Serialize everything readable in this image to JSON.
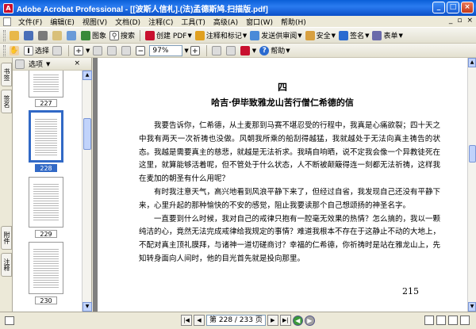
{
  "window": {
    "title": "Adobe Acrobat Professional - [[波斯人信札].(法)孟德斯鸠.扫描版.pdf]",
    "app_icon": "A",
    "min": "_",
    "max": "□",
    "close": "×"
  },
  "menu": {
    "items": [
      "文件(F)",
      "编辑(E)",
      "视图(V)",
      "文档(D)",
      "注释(C)",
      "工具(T)",
      "高级(A)",
      "窗口(W)",
      "帮助(H)"
    ],
    "right": [
      "_",
      "▫",
      "×"
    ]
  },
  "toolbar1": {
    "image_label": "图象",
    "search_label": "搜索",
    "create_pdf_label": "创建 PDF",
    "comment_label": "注释和标记",
    "send_review_label": "发送供审阅",
    "security_label": "安全",
    "sign_label": "签名",
    "forms_label": "表单"
  },
  "toolbar2": {
    "select_label": "选择",
    "zoom_value": "97%",
    "help_label": "帮助"
  },
  "nav_tabs": [
    "书签",
    "签名",
    "附件",
    "注释"
  ],
  "thumbs_panel": {
    "options_label": "选项",
    "close": "×",
    "thumbnails": [
      {
        "label": "227",
        "selected": false
      },
      {
        "label": "228",
        "selected": true
      },
      {
        "label": "229",
        "selected": false
      },
      {
        "label": "230",
        "selected": false
      }
    ]
  },
  "document": {
    "chapter": "四",
    "title": "哈吉·伊毕致雅龙山苦行僧仁希德的信",
    "paragraphs": [
      "我要告诉你，仁希德，从土麦那到马赛不堪忍受的行程中，我真是心痛欲裂；四十天之中我有两天一次祈祷也没做。风朝我所乘的船刮得越猛，我就越处于无法向真主祷告的状态。我越是需要真主的慈悲，就越是无法祈求。我晴自响晒，说不定我会像一个异教徒死在这里，就算能够活着呢，但不管处于什么状态，人不断被颠簸得连一刻都无法祈祷，这样我在麦加的朝圣有什么用呢？",
      "有时我注意天气，高兴地看到风浪平静下来了，但经过自省，我发现自己还没有平静下来，心里升起的那种愉快的不安的感觉，阻止我要读那个自己想颂扬的神圣名字。",
      "一直要到什么时候，我对自己的戒律只抱有一腔毫无效果的热情？怎么搞的，我以一颗纯洁的心，竟然无法完成戒律给我规定的事情？难道我根本不存在于这静止不动的大地上，不配对真主顶礼膜拜，与诸神一道切磋商讨？幸福的仁希德，你祈祷时是站在雅龙山上，先知转身面向人间时，他的目光首先就是投向那里。"
    ],
    "page_number": "215"
  },
  "status": {
    "first": "|◀",
    "prev": "◀",
    "page_display": "第 228 / 233 页",
    "next": "▶",
    "last": "▶|",
    "back": "◀",
    "forward": "▶"
  }
}
